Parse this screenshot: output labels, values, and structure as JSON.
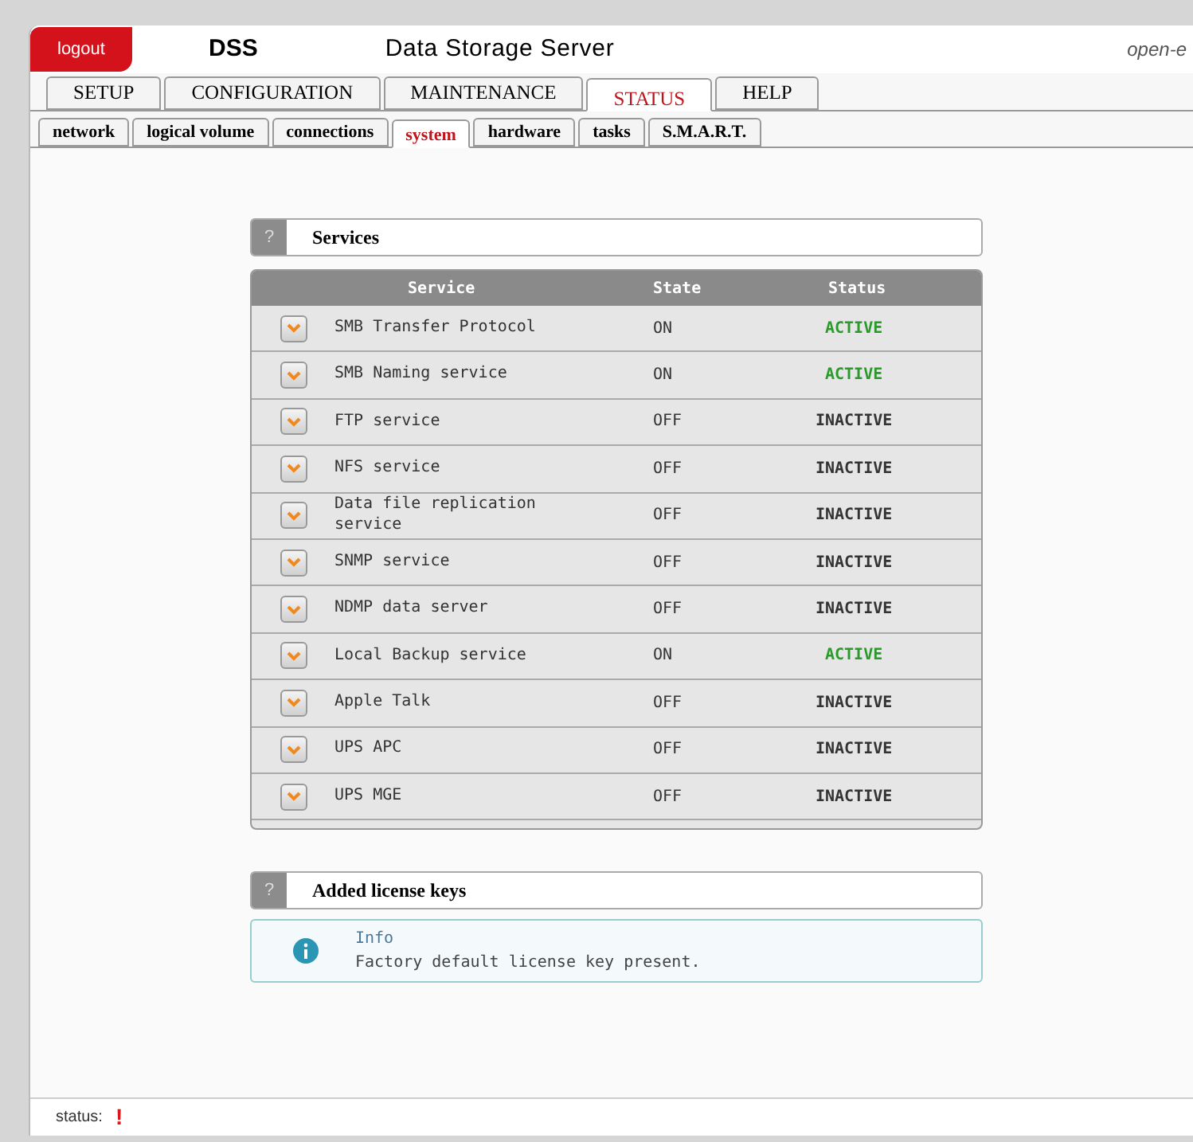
{
  "header": {
    "logout": "logout",
    "product": "DSS",
    "title": "Data Storage Server",
    "brand": "open-e"
  },
  "tabs": [
    {
      "label": "SETUP",
      "selected": false
    },
    {
      "label": "CONFIGURATION",
      "selected": false
    },
    {
      "label": "MAINTENANCE",
      "selected": false
    },
    {
      "label": "STATUS",
      "selected": true
    },
    {
      "label": "HELP",
      "selected": false
    }
  ],
  "subtabs": [
    {
      "label": "network",
      "selected": false
    },
    {
      "label": "logical volume",
      "selected": false
    },
    {
      "label": "connections",
      "selected": false
    },
    {
      "label": "system",
      "selected": true
    },
    {
      "label": "hardware",
      "selected": false
    },
    {
      "label": "tasks",
      "selected": false
    },
    {
      "label": "S.M.A.R.T.",
      "selected": false
    }
  ],
  "services": {
    "help": "?",
    "title": "Services",
    "columns": [
      "Service",
      "State",
      "Status"
    ],
    "rows": [
      {
        "service": "SMB Transfer Protocol",
        "state": "ON",
        "status": "ACTIVE",
        "active": true
      },
      {
        "service": "SMB Naming service",
        "state": "ON",
        "status": "ACTIVE",
        "active": true
      },
      {
        "service": "FTP service",
        "state": "OFF",
        "status": "INACTIVE",
        "active": false
      },
      {
        "service": "NFS service",
        "state": "OFF",
        "status": "INACTIVE",
        "active": false
      },
      {
        "service": "Data file replication service",
        "state": "OFF",
        "status": "INACTIVE",
        "active": false
      },
      {
        "service": "SNMP service",
        "state": "OFF",
        "status": "INACTIVE",
        "active": false
      },
      {
        "service": "NDMP data server",
        "state": "OFF",
        "status": "INACTIVE",
        "active": false
      },
      {
        "service": "Local Backup service",
        "state": "ON",
        "status": "ACTIVE",
        "active": true
      },
      {
        "service": "Apple Talk",
        "state": "OFF",
        "status": "INACTIVE",
        "active": false
      },
      {
        "service": "UPS APC",
        "state": "OFF",
        "status": "INACTIVE",
        "active": false
      },
      {
        "service": "UPS MGE",
        "state": "OFF",
        "status": "INACTIVE",
        "active": false
      }
    ]
  },
  "license": {
    "help": "?",
    "title": "Added license keys",
    "info_title": "Info",
    "info_text": "Factory default license key present."
  },
  "status_bar": {
    "label": "status:",
    "mark": "!"
  }
}
